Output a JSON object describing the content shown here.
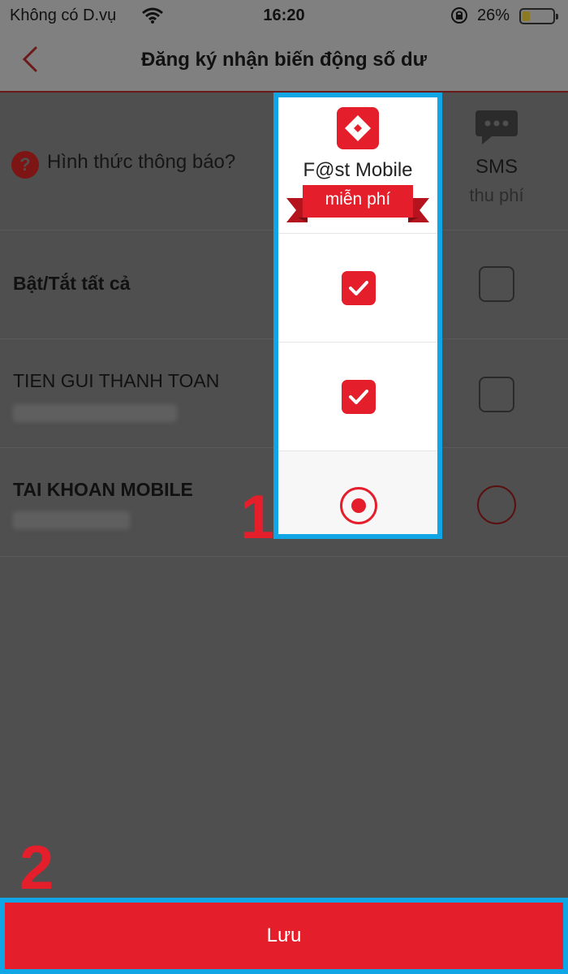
{
  "status_bar": {
    "carrier": "Không có D.vụ",
    "time": "16:20",
    "battery_percent_label": "26%",
    "battery_level": 0.26,
    "icons": [
      "wifi-icon",
      "rotation-lock-icon",
      "battery-icon"
    ]
  },
  "nav": {
    "back_icon": "chevron-left-icon",
    "title": "Đăng ký nhận biến động số dư"
  },
  "channels": {
    "question": "Hình thức thông báo?",
    "fast_mobile": {
      "name": "F@st Mobile",
      "tag": "miễn phí",
      "icon": "fast-mobile-logo-icon"
    },
    "sms": {
      "name": "SMS",
      "tag": "thu phí",
      "icon": "chat-bubble-icon"
    }
  },
  "rows": [
    {
      "label": "Bật/Tắt tất cả",
      "bold": true,
      "fast_mobile": "checked",
      "sms": "unchecked"
    },
    {
      "label": "TIEN GUI THANH TOAN",
      "bold": false,
      "account_masked": true,
      "fast_mobile": "checked",
      "sms": "unchecked"
    },
    {
      "label": "TAI KHOAN MOBILE",
      "bold": true,
      "account_masked": true,
      "fast_mobile": "radio-selected",
      "sms": "radio-unselected"
    }
  ],
  "annotations": {
    "step1": "1",
    "step2": "2"
  },
  "save_button": {
    "label": "Lưu"
  },
  "colors": {
    "accent": "#e41e2b",
    "highlight": "#10a6e6",
    "overlay": "#4f4f4f"
  }
}
